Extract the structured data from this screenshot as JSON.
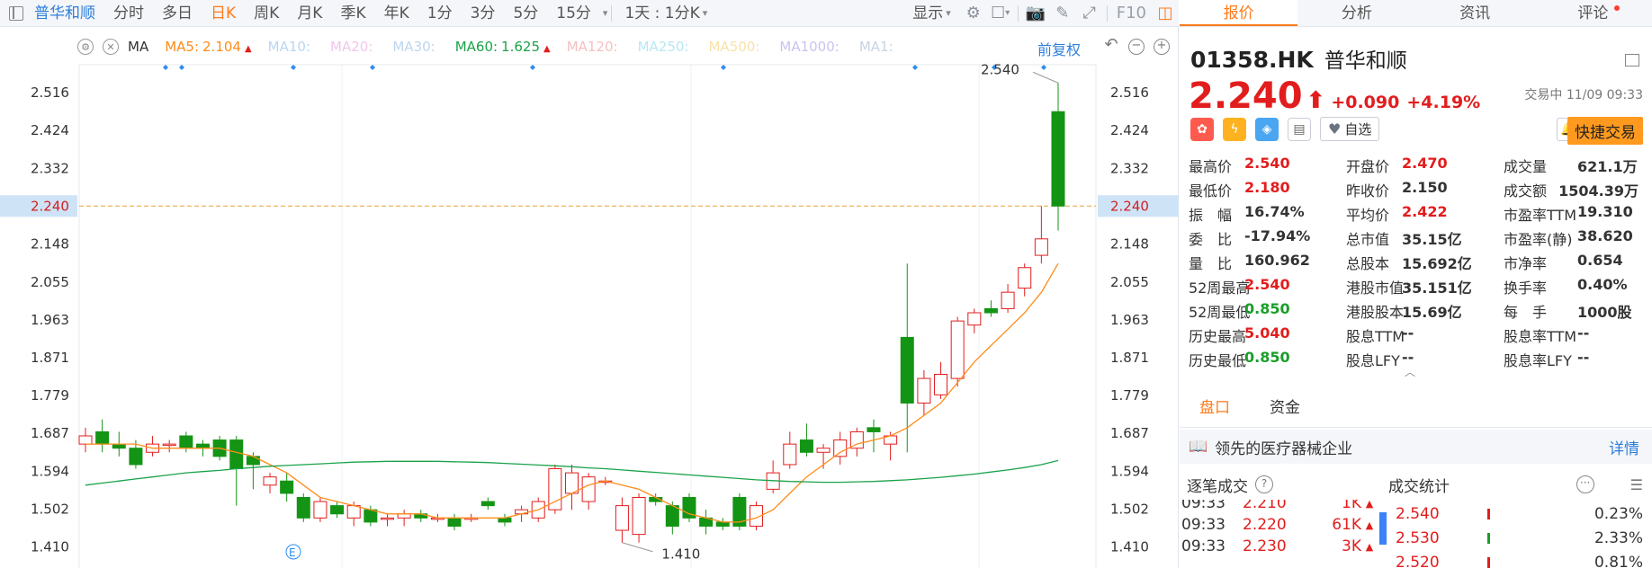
{
  "toolbar": {
    "stock_name": "普华和顺",
    "periods": [
      "分时",
      "多日",
      "日K",
      "周K",
      "月K",
      "季K",
      "年K",
      "1分",
      "3分",
      "5分",
      "15分"
    ],
    "active_period": "日K",
    "interval": "1天 : 1分K",
    "display": "显示",
    "f10": "F10"
  },
  "ma_bar": {
    "ma": "MA",
    "items": [
      {
        "label": "MA5:",
        "value": "2.104",
        "color": "#ff8c1a",
        "arrow": "▲"
      },
      {
        "label": "MA10:",
        "value": "",
        "color": "#b9d6f2",
        "arrow": ""
      },
      {
        "label": "MA20:",
        "value": "",
        "color": "#f0c7ea",
        "arrow": ""
      },
      {
        "label": "MA30:",
        "value": "",
        "color": "#bcd5f0",
        "arrow": ""
      },
      {
        "label": "MA60:",
        "value": "1.625",
        "color": "#1aa34a",
        "arrow": "▲"
      },
      {
        "label": "MA120:",
        "value": "",
        "color": "#f6c0c0",
        "arrow": ""
      },
      {
        "label": "MA250:",
        "value": "",
        "color": "#b8e8f5",
        "arrow": ""
      },
      {
        "label": "MA500:",
        "value": "",
        "color": "#f8e2a8",
        "arrow": ""
      },
      {
        "label": "MA1000:",
        "value": "",
        "color": "#c9c4ee",
        "arrow": ""
      },
      {
        "label": "MA1:",
        "value": "",
        "color": "#c7d3e2",
        "arrow": ""
      }
    ],
    "fuquan": "前复权"
  },
  "chart_data": {
    "type": "candlestick",
    "y_ticks": [
      "2.516",
      "2.424",
      "2.332",
      "2.240",
      "2.148",
      "2.055",
      "1.963",
      "1.871",
      "1.779",
      "1.687",
      "1.594",
      "1.502",
      "1.410"
    ],
    "ylim": [
      1.38,
      2.58
    ],
    "current_price": "2.240",
    "high_label": "2.540",
    "low_label": "1.410",
    "event_marker": "E",
    "candles": [
      {
        "o": 1.66,
        "h": 1.7,
        "l": 1.64,
        "c": 1.68
      },
      {
        "o": 1.69,
        "h": 1.72,
        "l": 1.64,
        "c": 1.66
      },
      {
        "o": 1.66,
        "h": 1.69,
        "l": 1.63,
        "c": 1.65
      },
      {
        "o": 1.65,
        "h": 1.67,
        "l": 1.6,
        "c": 1.61
      },
      {
        "o": 1.64,
        "h": 1.68,
        "l": 1.63,
        "c": 1.66
      },
      {
        "o": 1.66,
        "h": 1.67,
        "l": 1.64,
        "c": 1.66
      },
      {
        "o": 1.68,
        "h": 1.69,
        "l": 1.64,
        "c": 1.65
      },
      {
        "o": 1.66,
        "h": 1.67,
        "l": 1.63,
        "c": 1.65
      },
      {
        "o": 1.67,
        "h": 1.68,
        "l": 1.62,
        "c": 1.63
      },
      {
        "o": 1.67,
        "h": 1.68,
        "l": 1.51,
        "c": 1.6
      },
      {
        "o": 1.63,
        "h": 1.64,
        "l": 1.55,
        "c": 1.61
      },
      {
        "o": 1.56,
        "h": 1.59,
        "l": 1.54,
        "c": 1.58
      },
      {
        "o": 1.57,
        "h": 1.59,
        "l": 1.52,
        "c": 1.54
      },
      {
        "o": 1.53,
        "h": 1.54,
        "l": 1.47,
        "c": 1.48
      },
      {
        "o": 1.48,
        "h": 1.53,
        "l": 1.47,
        "c": 1.52
      },
      {
        "o": 1.51,
        "h": 1.52,
        "l": 1.48,
        "c": 1.49
      },
      {
        "o": 1.48,
        "h": 1.52,
        "l": 1.46,
        "c": 1.51
      },
      {
        "o": 1.5,
        "h": 1.51,
        "l": 1.46,
        "c": 1.47
      },
      {
        "o": 1.48,
        "h": 1.49,
        "l": 1.46,
        "c": 1.48
      },
      {
        "o": 1.48,
        "h": 1.5,
        "l": 1.46,
        "c": 1.49
      },
      {
        "o": 1.49,
        "h": 1.5,
        "l": 1.47,
        "c": 1.48
      },
      {
        "o": 1.48,
        "h": 1.49,
        "l": 1.47,
        "c": 1.48
      },
      {
        "o": 1.48,
        "h": 1.49,
        "l": 1.45,
        "c": 1.46
      },
      {
        "o": 1.48,
        "h": 1.49,
        "l": 1.47,
        "c": 1.48
      },
      {
        "o": 1.52,
        "h": 1.53,
        "l": 1.5,
        "c": 1.51
      },
      {
        "o": 1.48,
        "h": 1.49,
        "l": 1.46,
        "c": 1.47
      },
      {
        "o": 1.49,
        "h": 1.51,
        "l": 1.47,
        "c": 1.5
      },
      {
        "o": 1.48,
        "h": 1.53,
        "l": 1.47,
        "c": 1.52
      },
      {
        "o": 1.5,
        "h": 1.61,
        "l": 1.49,
        "c": 1.6
      },
      {
        "o": 1.54,
        "h": 1.61,
        "l": 1.5,
        "c": 1.59
      },
      {
        "o": 1.52,
        "h": 1.59,
        "l": 1.5,
        "c": 1.58
      },
      {
        "o": 1.57,
        "h": 1.58,
        "l": 1.56,
        "c": 1.57
      },
      {
        "o": 1.45,
        "h": 1.53,
        "l": 1.42,
        "c": 1.51
      },
      {
        "o": 1.44,
        "h": 1.54,
        "l": 1.42,
        "c": 1.53
      },
      {
        "o": 1.53,
        "h": 1.54,
        "l": 1.51,
        "c": 1.52
      },
      {
        "o": 1.51,
        "h": 1.52,
        "l": 1.44,
        "c": 1.46
      },
      {
        "o": 1.53,
        "h": 1.54,
        "l": 1.47,
        "c": 1.48
      },
      {
        "o": 1.48,
        "h": 1.5,
        "l": 1.44,
        "c": 1.46
      },
      {
        "o": 1.47,
        "h": 1.48,
        "l": 1.45,
        "c": 1.46
      },
      {
        "o": 1.53,
        "h": 1.54,
        "l": 1.45,
        "c": 1.46
      },
      {
        "o": 1.46,
        "h": 1.52,
        "l": 1.45,
        "c": 1.51
      },
      {
        "o": 1.55,
        "h": 1.62,
        "l": 1.54,
        "c": 1.59
      },
      {
        "o": 1.61,
        "h": 1.69,
        "l": 1.6,
        "c": 1.66
      },
      {
        "o": 1.67,
        "h": 1.71,
        "l": 1.63,
        "c": 1.64
      },
      {
        "o": 1.64,
        "h": 1.66,
        "l": 1.6,
        "c": 1.65
      },
      {
        "o": 1.63,
        "h": 1.69,
        "l": 1.61,
        "c": 1.67
      },
      {
        "o": 1.65,
        "h": 1.7,
        "l": 1.63,
        "c": 1.69
      },
      {
        "o": 1.7,
        "h": 1.72,
        "l": 1.64,
        "c": 1.69
      },
      {
        "o": 1.66,
        "h": 1.69,
        "l": 1.62,
        "c": 1.68
      },
      {
        "o": 1.92,
        "h": 2.1,
        "l": 1.64,
        "c": 1.76
      },
      {
        "o": 1.76,
        "h": 1.84,
        "l": 1.73,
        "c": 1.82
      },
      {
        "o": 1.78,
        "h": 1.86,
        "l": 1.77,
        "c": 1.83
      },
      {
        "o": 1.82,
        "h": 1.97,
        "l": 1.8,
        "c": 1.96
      },
      {
        "o": 1.95,
        "h": 1.99,
        "l": 1.93,
        "c": 1.98
      },
      {
        "o": 1.99,
        "h": 2.01,
        "l": 1.97,
        "c": 1.98
      },
      {
        "o": 1.99,
        "h": 2.05,
        "l": 1.98,
        "c": 2.03
      },
      {
        "o": 2.04,
        "h": 2.1,
        "l": 2.02,
        "c": 2.09
      },
      {
        "o": 2.12,
        "h": 2.24,
        "l": 2.1,
        "c": 2.16
      },
      {
        "o": 2.47,
        "h": 2.54,
        "l": 2.18,
        "c": 2.24
      }
    ],
    "ma5": [
      1.66,
      1.66,
      1.66,
      1.66,
      1.65,
      1.65,
      1.65,
      1.65,
      1.65,
      1.64,
      1.63,
      1.61,
      1.59,
      1.56,
      1.53,
      1.52,
      1.51,
      1.5,
      1.49,
      1.49,
      1.49,
      1.48,
      1.48,
      1.48,
      1.48,
      1.48,
      1.49,
      1.5,
      1.52,
      1.54,
      1.56,
      1.57,
      1.56,
      1.55,
      1.53,
      1.51,
      1.49,
      1.48,
      1.47,
      1.47,
      1.48,
      1.5,
      1.54,
      1.58,
      1.61,
      1.64,
      1.66,
      1.67,
      1.68,
      1.7,
      1.73,
      1.76,
      1.81,
      1.86,
      1.9,
      1.94,
      1.98,
      2.03,
      2.1
    ],
    "ma60": [
      1.56,
      1.565,
      1.57,
      1.575,
      1.58,
      1.585,
      1.59,
      1.593,
      1.596,
      1.6,
      1.603,
      1.606,
      1.608,
      1.61,
      1.612,
      1.614,
      1.616,
      1.617,
      1.618,
      1.618,
      1.618,
      1.618,
      1.617,
      1.616,
      1.615,
      1.613,
      1.611,
      1.609,
      1.607,
      1.605,
      1.602,
      1.6,
      1.597,
      1.594,
      1.591,
      1.588,
      1.585,
      1.582,
      1.579,
      1.576,
      1.573,
      1.571,
      1.569,
      1.568,
      1.567,
      1.567,
      1.568,
      1.569,
      1.571,
      1.573,
      1.576,
      1.579,
      1.583,
      1.587,
      1.592,
      1.597,
      1.603,
      1.61,
      1.62
    ]
  },
  "right": {
    "tabs": [
      "报价",
      "分析",
      "资讯",
      "评论"
    ],
    "active_tab": "报价",
    "code": "01358.HK",
    "name": "普华和顺",
    "price": "2.240",
    "arrow": "⬆",
    "change": "+0.090",
    "change_pct": "+4.19%",
    "status": "交易中 11/09 09:33",
    "watch": "自选",
    "fast_trade": "快捷交易",
    "quotes": [
      [
        {
          "label": "最高价",
          "value": "2.540",
          "c": "red"
        },
        {
          "label": "开盘价",
          "value": "2.470",
          "c": "red"
        },
        {
          "label": "成交量",
          "value": "621.1万",
          "c": ""
        }
      ],
      [
        {
          "label": "最低价",
          "value": "2.180",
          "c": "red"
        },
        {
          "label": "昨收价",
          "value": "2.150",
          "c": ""
        },
        {
          "label": "成交额",
          "value": "1504.39万",
          "c": ""
        }
      ],
      [
        {
          "label": "振　幅",
          "value": "16.74%",
          "c": ""
        },
        {
          "label": "平均价",
          "value": "2.422",
          "c": "red"
        },
        {
          "label": "市盈率TTM",
          "value": "19.310",
          "c": ""
        }
      ],
      [
        {
          "label": "委　比",
          "value": "-17.94%",
          "c": ""
        },
        {
          "label": "总市值",
          "value": "35.15亿",
          "c": ""
        },
        {
          "label": "市盈率(静)",
          "value": "38.620",
          "c": ""
        }
      ],
      [
        {
          "label": "量　比",
          "value": "160.962",
          "c": ""
        },
        {
          "label": "总股本",
          "value": "15.692亿",
          "c": ""
        },
        {
          "label": "市净率",
          "value": "0.654",
          "c": ""
        }
      ],
      [
        {
          "label": "52周最高",
          "value": "2.540",
          "c": "red"
        },
        {
          "label": "港股市值",
          "value": "35.151亿",
          "c": ""
        },
        {
          "label": "换手率",
          "value": "0.40%",
          "c": ""
        }
      ],
      [
        {
          "label": "52周最低",
          "value": "0.850",
          "c": "green"
        },
        {
          "label": "港股股本",
          "value": "15.69亿",
          "c": ""
        },
        {
          "label": "每　手",
          "value": "1000股",
          "c": ""
        }
      ],
      [
        {
          "label": "历史最高",
          "value": "5.040",
          "c": "red"
        },
        {
          "label": "股息TTM",
          "value": "--",
          "c": ""
        },
        {
          "label": "股息率TTM",
          "value": "--",
          "c": ""
        }
      ],
      [
        {
          "label": "历史最低",
          "value": "0.850",
          "c": "green"
        },
        {
          "label": "股息LFY",
          "value": "--",
          "c": ""
        },
        {
          "label": "股息率LFY",
          "value": "--",
          "c": ""
        }
      ]
    ],
    "subtabs": [
      "盘口",
      "资金"
    ],
    "industry": "领先的医疗器械企业",
    "detail": "详情",
    "trades_title": "逐笔成交",
    "stats_title": "成交统计",
    "ticks": [
      {
        "time": "09:33",
        "price": "2.210",
        "vol": "1K"
      },
      {
        "time": "09:33",
        "price": "2.220",
        "vol": "61K"
      },
      {
        "time": "09:33",
        "price": "2.230",
        "vol": "3K"
      }
    ],
    "distribution": [
      {
        "price": "2.540",
        "pct": "0.23%",
        "bar": "red"
      },
      {
        "price": "2.530",
        "pct": "2.33%",
        "bar": "green"
      },
      {
        "price": "2.520",
        "pct": "0.81%",
        "bar": "red"
      }
    ]
  }
}
